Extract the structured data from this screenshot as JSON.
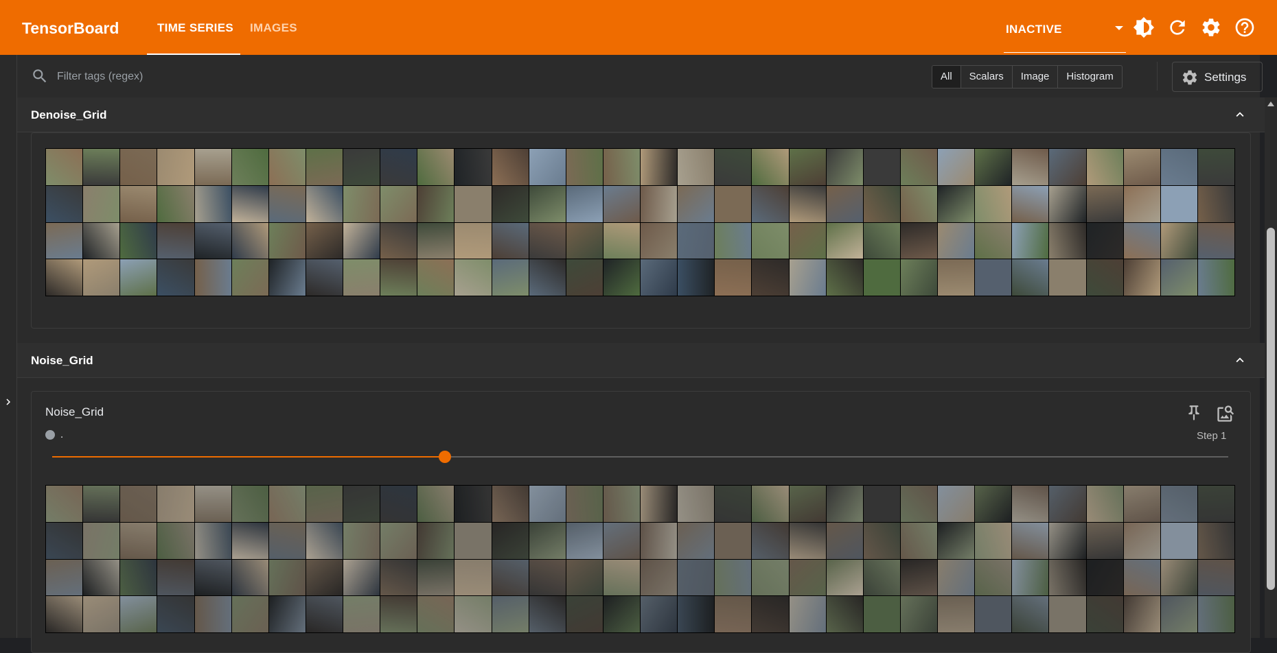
{
  "app": {
    "title": "TensorBoard"
  },
  "nav": {
    "tabs": [
      {
        "label": "TIME SERIES"
      },
      {
        "label": "IMAGES"
      }
    ]
  },
  "header": {
    "run_status": "INACTIVE"
  },
  "filter": {
    "placeholder": "Filter tags (regex)",
    "types": [
      {
        "label": "All"
      },
      {
        "label": "Scalars"
      },
      {
        "label": "Image"
      },
      {
        "label": "Histogram"
      }
    ],
    "settings_label": "Settings"
  },
  "groups": [
    {
      "title": "Denoise_Grid"
    },
    {
      "title": "Noise_Grid",
      "card": {
        "title": "Noise_Grid",
        "run": ".",
        "step": "Step 1",
        "slider_fraction": 0.334
      }
    }
  ],
  "colors": {
    "accent": "#ef6c00",
    "background": "#2b2b2b"
  },
  "icons": {
    "theme": "brightness-icon",
    "refresh": "refresh-icon",
    "settings": "gear-icon",
    "help": "help-icon",
    "pin": "pin-icon",
    "fullscreen": "image-search-icon",
    "collapse": "chevron-up-icon",
    "expand_sidebar": "chevron-right-icon",
    "search": "search-icon"
  }
}
